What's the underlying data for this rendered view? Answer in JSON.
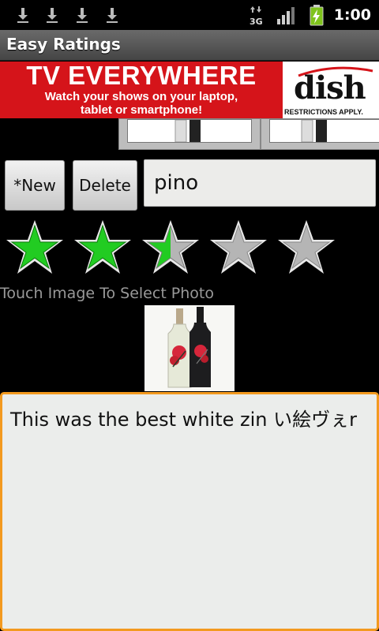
{
  "status_bar": {
    "icons": [
      "download-icon",
      "download-icon",
      "download-icon",
      "download-icon",
      "3g-icon",
      "signal-icon",
      "battery-charging-icon"
    ],
    "network_label": "3G",
    "time": "1:00"
  },
  "app": {
    "title": "Easy Ratings"
  },
  "ad": {
    "headline": "TV EVERYWHERE",
    "subline_1": "Watch your shows on your laptop,",
    "subline_2": "tablet or smartphone!",
    "brand": "dish",
    "disclaimer": "RESTRICTIONS APPLY.",
    "brand_color": "#d5141a"
  },
  "toolbar": {
    "new_label": "*New",
    "delete_label": "Delete",
    "name_value": "pino"
  },
  "rating": {
    "value": 2.5,
    "max": 5,
    "fill_color": "#22cc22",
    "empty_color": "#b5b5b5"
  },
  "photo": {
    "hint": "Touch Image To Select Photo"
  },
  "notes": {
    "value": "This was the best white zin い絵ヴぇr"
  },
  "colors": {
    "focus": "#f39a1f",
    "title_bar": "#555555"
  }
}
